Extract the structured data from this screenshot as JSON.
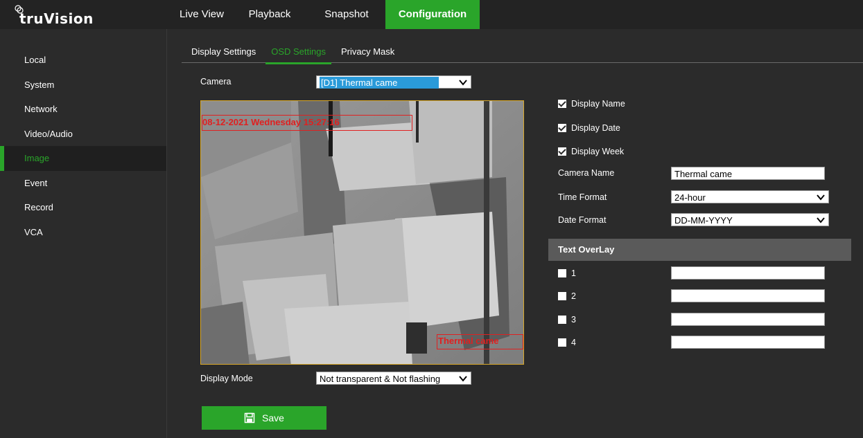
{
  "brand": {
    "name": "truVision"
  },
  "topnav": [
    {
      "label": "Live View",
      "active": false
    },
    {
      "label": "Playback",
      "active": false
    },
    {
      "label": "Snapshot",
      "active": false
    },
    {
      "label": "Configuration",
      "active": true
    }
  ],
  "sidebar": {
    "items": [
      {
        "label": "Local"
      },
      {
        "label": "System"
      },
      {
        "label": "Network"
      },
      {
        "label": "Video/Audio"
      },
      {
        "label": "Image",
        "active": true
      },
      {
        "label": "Event"
      },
      {
        "label": "Record"
      },
      {
        "label": "VCA"
      }
    ]
  },
  "subtabs": [
    {
      "label": "Display Settings"
    },
    {
      "label": "OSD Settings",
      "active": true
    },
    {
      "label": "Privacy Mask"
    }
  ],
  "camera": {
    "label": "Camera",
    "value": "[D1] Thermal came"
  },
  "video": {
    "osd_date_text": "08-12-2021 Wednesday 15:27:16",
    "osd_name_text": "Thermal came"
  },
  "display": {
    "name": {
      "label": "Display Name",
      "checked": true
    },
    "date": {
      "label": "Display Date",
      "checked": true
    },
    "week": {
      "label": "Display Week",
      "checked": true
    }
  },
  "fields": {
    "camera_name": {
      "label": "Camera Name",
      "value": "Thermal came"
    },
    "time_format": {
      "label": "Time Format",
      "value": "24-hour"
    },
    "date_format": {
      "label": "Date Format",
      "value": "DD-MM-YYYY"
    }
  },
  "text_overlay": {
    "header": "Text OverLay",
    "rows": [
      {
        "label": "1",
        "checked": false,
        "value": ""
      },
      {
        "label": "2",
        "checked": false,
        "value": ""
      },
      {
        "label": "3",
        "checked": false,
        "value": ""
      },
      {
        "label": "4",
        "checked": false,
        "value": ""
      }
    ]
  },
  "display_mode": {
    "label": "Display Mode",
    "value": "Not transparent & Not flashing"
  },
  "save": {
    "label": "Save"
  },
  "colors": {
    "accent": "#2aa52a",
    "background": "#2b2b2b",
    "topbar": "#232323",
    "osd_red": "#e02020",
    "video_border": "#d8a82a"
  }
}
